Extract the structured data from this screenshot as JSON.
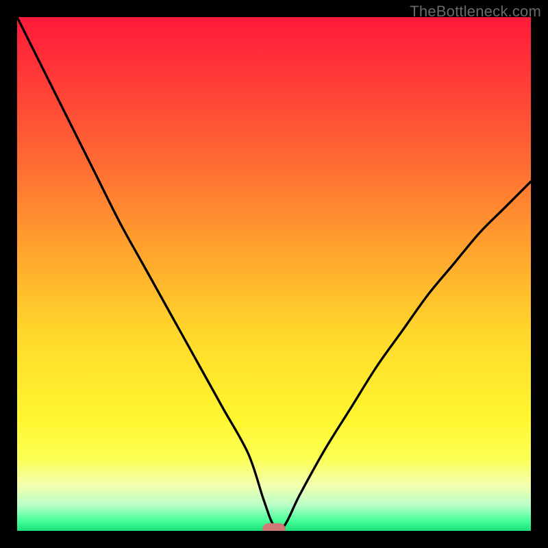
{
  "watermark": "TheBottleneck.com",
  "chart_data": {
    "type": "line",
    "title": "",
    "xlabel": "",
    "ylabel": "",
    "xlim": [
      0,
      100
    ],
    "ylim": [
      0,
      100
    ],
    "x": [
      0,
      5,
      10,
      15,
      20,
      25,
      30,
      35,
      40,
      45,
      48,
      50,
      52,
      55,
      60,
      65,
      70,
      75,
      80,
      85,
      90,
      95,
      100
    ],
    "values": [
      100,
      90,
      80,
      70,
      60,
      51,
      42,
      33,
      24,
      15,
      6,
      1,
      1,
      7,
      16,
      24,
      32,
      39,
      46,
      52,
      58,
      63,
      68
    ],
    "marker": {
      "x": 50,
      "y": 0,
      "color": "#cf7a74",
      "w": 4.5,
      "h": 2.4,
      "rx": 1.2
    },
    "gradient_stops": [
      {
        "offset": 0.0,
        "color": "#ff1a3a"
      },
      {
        "offset": 0.12,
        "color": "#ff3a38"
      },
      {
        "offset": 0.28,
        "color": "#ff6a33"
      },
      {
        "offset": 0.45,
        "color": "#ffa22e"
      },
      {
        "offset": 0.62,
        "color": "#ffd92b"
      },
      {
        "offset": 0.78,
        "color": "#fff62f"
      },
      {
        "offset": 0.86,
        "color": "#fcff55"
      },
      {
        "offset": 0.91,
        "color": "#f4ffae"
      },
      {
        "offset": 0.95,
        "color": "#b9ffc8"
      },
      {
        "offset": 0.98,
        "color": "#49ff9a"
      },
      {
        "offset": 1.0,
        "color": "#18e07a"
      }
    ],
    "curve_color": "#000000"
  }
}
